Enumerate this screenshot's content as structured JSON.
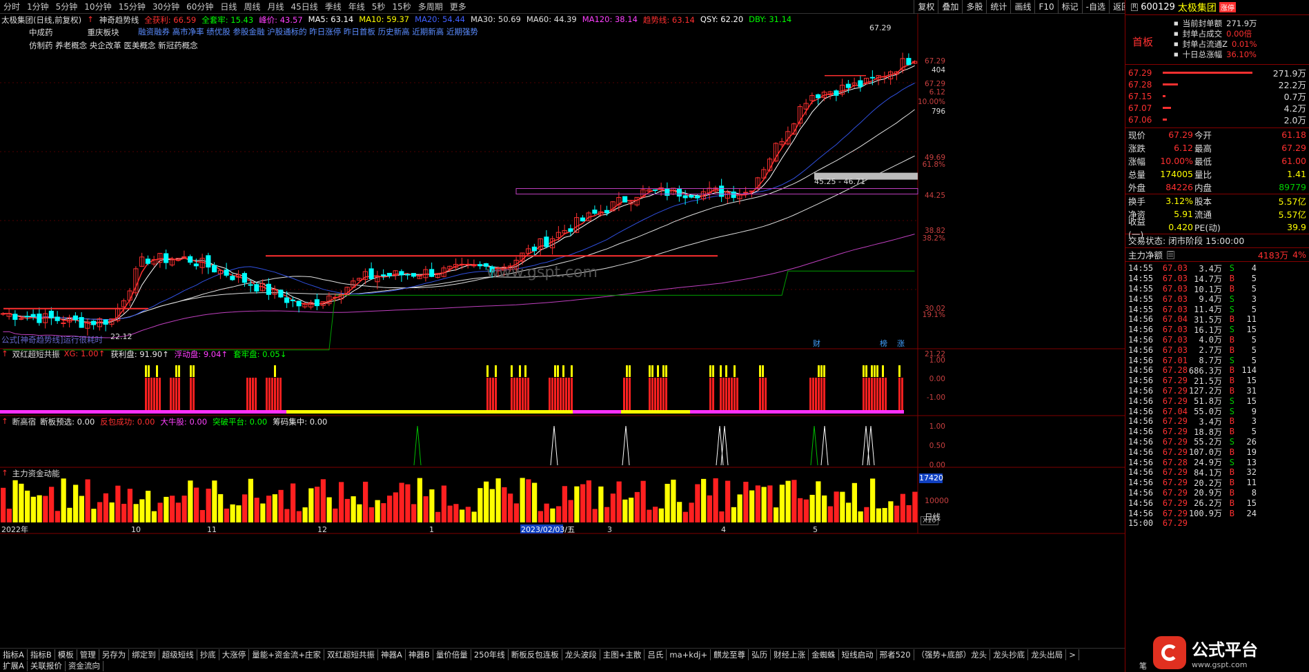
{
  "periods": [
    "分时",
    "1分钟",
    "5分钟",
    "10分钟",
    "15分钟",
    "30分钟",
    "60分钟",
    "日线",
    "周线",
    "月线",
    "45日线",
    "季线",
    "年线",
    "5秒",
    "15秒",
    "多周期",
    "更多"
  ],
  "tools": [
    "复权",
    "叠加",
    "多股",
    "统计",
    "画线",
    "F10",
    "标记",
    "-自选",
    "返回"
  ],
  "chart": {
    "header_title": "太极集团(日线,前复权)",
    "indicator_name": "神奇趋势线",
    "legend": [
      {
        "label": "全获利: 66.59",
        "color": "#ff3030"
      },
      {
        "label": "全套牢: 15.43",
        "color": "#00ff00"
      },
      {
        "label": "峰价: 43.57",
        "color": "#ff40ff"
      },
      {
        "label": "MA5: 63.14",
        "color": "#ffffff"
      },
      {
        "label": "MA10: 59.37",
        "color": "#ffff00"
      },
      {
        "label": "MA20: 54.44",
        "color": "#4060ff"
      },
      {
        "label": "MA30: 50.69",
        "color": "#e0e0e0"
      },
      {
        "label": "MA60: 44.39",
        "color": "#e0e0e0"
      },
      {
        "label": "MA120: 38.14",
        "color": "#ff40ff"
      },
      {
        "label": "趋势线: 63.14",
        "color": "#ff3030"
      },
      {
        "label": "QSY: 62.20",
        "color": "#ffffff"
      },
      {
        "label": "DBY: 31.14",
        "color": "#00ff00"
      }
    ],
    "concept_line1": [
      "中成药",
      "重庆板块"
    ],
    "concept_blue": "融资融券 高市净率 绩优股 参股金融 沪股通标的 昨日涨停 昨日首板 历史新高 近期新高 近期强势",
    "concept_line2": "仿制药 养老概念 央企改革 医美概念 新冠药概念",
    "price_labels": [
      "67.29",
      "404",
      "67.29",
      "6.12",
      "10.00%",
      "796",
      "49.69",
      "61.8%",
      "44.25",
      "38.82",
      "38.2%",
      "30.02",
      "19.1%",
      "21.22"
    ],
    "low_label": "22.12",
    "high_label": "67.29",
    "range_label": "45.25 - 46.71",
    "watermark": "www.gspt.com",
    "formula_note": "公式[神奇趋势线]运行很耗时",
    "tags": [
      "财",
      "榜",
      "涨"
    ],
    "months": [
      "2022年",
      "10",
      "11",
      "12",
      "1",
      "2023/02/03/五",
      "3",
      "4",
      "5"
    ]
  },
  "panel2": {
    "name": "双红超短共振",
    "items": [
      {
        "label": "XG: 1.00↑",
        "color": "#ff3030"
      },
      {
        "label": "获利盘: 91.90↑",
        "color": "#e8e8e8"
      },
      {
        "label": "浮动盘: 9.04↑",
        "color": "#ff40ff"
      },
      {
        "label": "套牢盘: 0.05↓",
        "color": "#00ff00"
      }
    ],
    "axis": [
      "1.00",
      "0.00",
      "-1.00"
    ]
  },
  "panel3": {
    "name": "断高宿",
    "items": [
      {
        "label": "断板预选: 0.00",
        "color": "#e8e8e8"
      },
      {
        "label": "反包成功: 0.00",
        "color": "#ff3030"
      },
      {
        "label": "大牛股: 0.00",
        "color": "#ff40ff"
      },
      {
        "label": "突破平台: 0.00",
        "color": "#00ff00"
      },
      {
        "label": "筹码集中: 0.00",
        "color": "#e8e8e8"
      }
    ],
    "axis": [
      "1.00",
      "0.50",
      "0.00"
    ]
  },
  "panel4": {
    "name": "主力资金动能",
    "axis_badge": "17420",
    "axis": [
      "10000"
    ],
    "unit": "X10"
  },
  "tabs_row1": [
    "指标A",
    "指标B",
    "模板",
    "管理",
    "另存为",
    "绑定到",
    "超级短线",
    "抄底",
    "大涨停",
    "量能+资金流+庄家",
    "双红超短共振",
    "神器A",
    "神器B",
    "量价倍量",
    "250年线",
    "断板反包连板",
    "龙头波段",
    "主图+主散",
    "吕氏",
    "ma+kdj+",
    "麒龙至尊",
    "弘历",
    "财经上涨",
    "金蜘蛛",
    "短线启动",
    "邢者520",
    "（强势+底部）龙头",
    "龙头抄底",
    "龙头出局",
    ">"
  ],
  "tabs_row2": [
    "扩展A",
    "关联报价",
    "资金流向"
  ],
  "period_right": "日线",
  "side": {
    "code": "600129",
    "name": "太极集团",
    "badge": "R",
    "zt_badge": "涨停",
    "first_board": "首板",
    "seal_info": [
      {
        "k": "当前封单额",
        "v": "271.9万"
      },
      {
        "k": "封单占成交",
        "v": "0.00倍"
      },
      {
        "k": "封单占流通Z",
        "v": "0.01%"
      },
      {
        "k": "十日总涨幅",
        "v": "36.10%"
      }
    ],
    "bids": [
      {
        "p": "67.29",
        "v": "271.9万"
      },
      {
        "p": "67.28",
        "v": "22.2万"
      },
      {
        "p": "67.15",
        "v": "0.7万"
      },
      {
        "p": "67.07",
        "v": "4.2万"
      },
      {
        "p": "67.06",
        "v": "2.0万"
      }
    ],
    "quote": [
      {
        "k1": "现价",
        "v1": "67.29",
        "k2": "今开",
        "v2": "61.18"
      },
      {
        "k1": "涨跌",
        "v1": "6.12",
        "k2": "最高",
        "v2": "67.29"
      },
      {
        "k1": "涨幅",
        "v1": "10.00%",
        "k2": "最低",
        "v2": "61.00"
      },
      {
        "k1": "总量",
        "v1": "174005",
        "k2": "量比",
        "v2": "1.41"
      },
      {
        "k1": "外盘",
        "v1": "84226",
        "k2": "内盘",
        "v2": "89779"
      }
    ],
    "quote2": [
      {
        "k1": "换手",
        "v1": "3.12%",
        "k2": "股本",
        "v2": "5.57亿"
      },
      {
        "k1": "净资",
        "v1": "5.91",
        "k2": "流通",
        "v2": "5.57亿"
      },
      {
        "k1": "收益(一)",
        "v1": "0.420",
        "k2": "PE(动)",
        "v2": "39.9"
      }
    ],
    "trade_status": "交易状态: 闭市阶段 15:00:00",
    "net_label": "主力净额",
    "net_value": "4183万",
    "net_pct": "4%",
    "trades": [
      [
        "14:55",
        "67.03",
        "3.4万",
        "S",
        "4"
      ],
      [
        "14:55",
        "67.03",
        "14.7万",
        "B",
        "5"
      ],
      [
        "14:55",
        "67.03",
        "10.1万",
        "B",
        "5"
      ],
      [
        "14:55",
        "67.03",
        "9.4万",
        "S",
        "3"
      ],
      [
        "14:55",
        "67.03",
        "11.4万",
        "S",
        "5"
      ],
      [
        "14:56",
        "67.04",
        "31.5万",
        "B",
        "11"
      ],
      [
        "14:56",
        "67.03",
        "16.1万",
        "S",
        "15"
      ],
      [
        "14:56",
        "67.03",
        "4.0万",
        "B",
        "5"
      ],
      [
        "14:56",
        "67.03",
        "2.7万",
        "B",
        "5"
      ],
      [
        "14:56",
        "67.01",
        "8.7万",
        "S",
        "5"
      ],
      [
        "14:56",
        "67.28",
        "686.3万",
        "B",
        "114"
      ],
      [
        "14:56",
        "67.29",
        "21.5万",
        "B",
        "15"
      ],
      [
        "14:56",
        "67.29",
        "127.2万",
        "B",
        "31"
      ],
      [
        "14:56",
        "67.29",
        "51.8万",
        "S",
        "15"
      ],
      [
        "14:56",
        "67.04",
        "55.0万",
        "S",
        "9"
      ],
      [
        "14:56",
        "67.29",
        "3.4万",
        "B",
        "3"
      ],
      [
        "14:56",
        "67.29",
        "18.8万",
        "B",
        "5"
      ],
      [
        "14:56",
        "67.29",
        "55.2万",
        "S",
        "26"
      ],
      [
        "14:56",
        "67.29",
        "107.0万",
        "B",
        "19"
      ],
      [
        "14:56",
        "67.28",
        "24.9万",
        "S",
        "13"
      ],
      [
        "14:56",
        "67.29",
        "84.1万",
        "B",
        "32"
      ],
      [
        "14:56",
        "67.29",
        "20.2万",
        "B",
        "11"
      ],
      [
        "14:56",
        "67.29",
        "20.9万",
        "B",
        "8"
      ],
      [
        "14:56",
        "67.29",
        "26.2万",
        "B",
        "15"
      ],
      [
        "14:56",
        "67.29",
        "100.9万",
        "B",
        "24"
      ],
      [
        "15:00",
        "67.29",
        "",
        "",
        ""
      ]
    ],
    "logo_text": "公式平台",
    "logo_url": "www.gspt.com",
    "bottom_label": "笔"
  },
  "colors": {
    "up": "#ff3030",
    "down": "#00ffff",
    "bg": "#000000",
    "grid": "#800000"
  }
}
